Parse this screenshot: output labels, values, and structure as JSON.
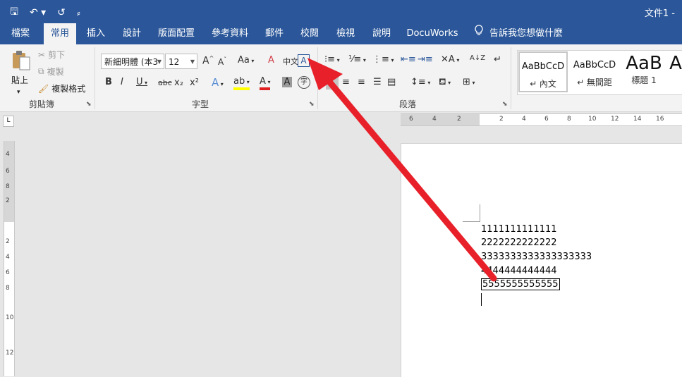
{
  "titlebar": {
    "doc_title": "文件1 -",
    "qat": {
      "save": "🖫",
      "undo": "↶ ▾",
      "redo": "↺",
      "customize": "⸗"
    }
  },
  "tabs": [
    {
      "label": "檔案"
    },
    {
      "label": "常用"
    },
    {
      "label": "插入"
    },
    {
      "label": "設計"
    },
    {
      "label": "版面配置"
    },
    {
      "label": "參考資料"
    },
    {
      "label": "郵件"
    },
    {
      "label": "校閱"
    },
    {
      "label": "檢視"
    },
    {
      "label": "說明"
    },
    {
      "label": "DocuWorks"
    }
  ],
  "tell_me": "告訴我您想做什麼",
  "clipboard": {
    "paste": "貼上",
    "paste_arrow": "▾",
    "cut": "剪下",
    "copy": "複製",
    "format_painter": "複製格式",
    "group_label": "剪貼簿"
  },
  "font": {
    "font_name": "新細明體 (本3",
    "font_size": "12",
    "group_label": "字型",
    "grow": "A",
    "shrink": "A",
    "change_case": "Aa",
    "clear_format": "A",
    "phonetic": "中文",
    "char_border": "A",
    "bold": "B",
    "italic": "I",
    "underline": "U",
    "strike": "abc",
    "subscript": "x₂",
    "superscript": "x²",
    "text_effect": "A",
    "highlight": "ab",
    "font_color": "A",
    "char_shading": "A",
    "enclose": "字"
  },
  "paragraph": {
    "group_label": "段落",
    "sort": "A↓Z"
  },
  "styles": [
    {
      "sample": "AaBbCcD",
      "name": "↵ 內文"
    },
    {
      "sample": "AaBbCcD",
      "name": "↵ 無間距"
    },
    {
      "sample": "AaB",
      "name": "標題 1"
    },
    {
      "sample": "A",
      "name": ""
    }
  ],
  "ruler": {
    "tab_selector": "L",
    "h_ticks": [
      "6",
      "4",
      "2",
      "2",
      "4",
      "6",
      "8",
      "10",
      "12",
      "14",
      "16"
    ],
    "v_ticks": [
      "4",
      "6",
      "8",
      "2",
      "2",
      "4",
      "6",
      "8",
      "10",
      "12"
    ]
  },
  "document": {
    "lines": [
      "1111111111111",
      "2222222222222",
      "3333333333333333333",
      "4444444444444",
      "5555555555555"
    ]
  },
  "colors": {
    "brand": "#2b579a",
    "arrow": "#e8202a"
  }
}
